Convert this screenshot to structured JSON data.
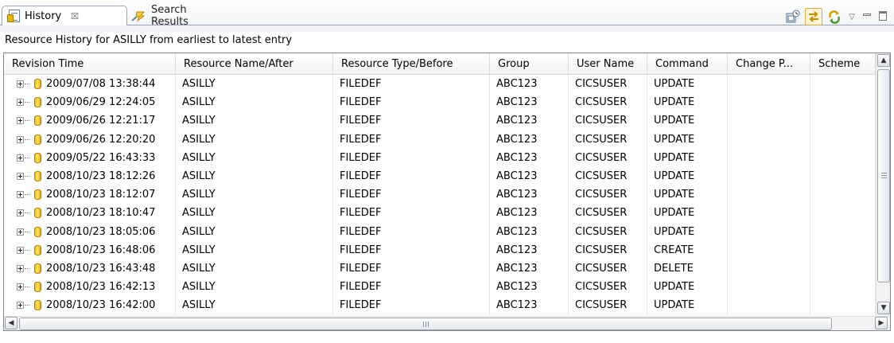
{
  "tabs": [
    {
      "label": "History",
      "icon": "history-view-icon",
      "active": true,
      "close_symbol": "☒"
    },
    {
      "label": "Search Results",
      "icon": "search-results-icon",
      "active": false
    }
  ],
  "toolbar": {
    "icons": [
      "show-history-icon",
      "link-with-editor-icon",
      "refresh-icon"
    ],
    "view_menu_icon": "view-menu-icon",
    "minimize_icon": "minimize-icon",
    "maximize_icon": "maximize-icon"
  },
  "description": "Resource History for ASILLY from earliest to latest entry",
  "table": {
    "columns": [
      "Revision Time",
      "Resource Name/After",
      "Resource Type/Before",
      "Group",
      "User Name",
      "Command",
      "Change P...",
      "Scheme"
    ],
    "rows": [
      [
        "2009/07/08 13:38:44",
        "ASILLY",
        "FILEDEF",
        "ABC123",
        "CICSUSER",
        "UPDATE",
        "",
        ""
      ],
      [
        "2009/06/29 12:24:05",
        "ASILLY",
        "FILEDEF",
        "ABC123",
        "CICSUSER",
        "UPDATE",
        "",
        ""
      ],
      [
        "2009/06/26 12:21:17",
        "ASILLY",
        "FILEDEF",
        "ABC123",
        "CICSUSER",
        "UPDATE",
        "",
        ""
      ],
      [
        "2009/06/26 12:20:20",
        "ASILLY",
        "FILEDEF",
        "ABC123",
        "CICSUSER",
        "UPDATE",
        "",
        ""
      ],
      [
        "2009/05/22 16:43:33",
        "ASILLY",
        "FILEDEF",
        "ABC123",
        "CICSUSER",
        "UPDATE",
        "",
        ""
      ],
      [
        "2008/10/23 18:12:26",
        "ASILLY",
        "FILEDEF",
        "ABC123",
        "CICSUSER",
        "UPDATE",
        "",
        ""
      ],
      [
        "2008/10/23 18:12:07",
        "ASILLY",
        "FILEDEF",
        "ABC123",
        "CICSUSER",
        "UPDATE",
        "",
        ""
      ],
      [
        "2008/10/23 18:10:47",
        "ASILLY",
        "FILEDEF",
        "ABC123",
        "CICSUSER",
        "UPDATE",
        "",
        ""
      ],
      [
        "2008/10/23 18:05:06",
        "ASILLY",
        "FILEDEF",
        "ABC123",
        "CICSUSER",
        "UPDATE",
        "",
        ""
      ],
      [
        "2008/10/23 16:48:06",
        "ASILLY",
        "FILEDEF",
        "ABC123",
        "CICSUSER",
        "CREATE",
        "",
        ""
      ],
      [
        "2008/10/23 16:43:48",
        "ASILLY",
        "FILEDEF",
        "ABC123",
        "CICSUSER",
        "DELETE",
        "",
        ""
      ],
      [
        "2008/10/23 16:42:13",
        "ASILLY",
        "FILEDEF",
        "ABC123",
        "CICSUSER",
        "UPDATE",
        "",
        ""
      ],
      [
        "2008/10/23 16:42:00",
        "ASILLY",
        "FILEDEF",
        "ABC123",
        "CICSUSER",
        "UPDATE",
        "",
        ""
      ]
    ],
    "row_icon": "resource-cylinder-icon",
    "expander_icon": "tree-expand-icon"
  },
  "colors": {
    "tab_border": "#9aa6b4",
    "resource_icon": "#f2c200",
    "pressed_toggle": "#e1a93c"
  }
}
